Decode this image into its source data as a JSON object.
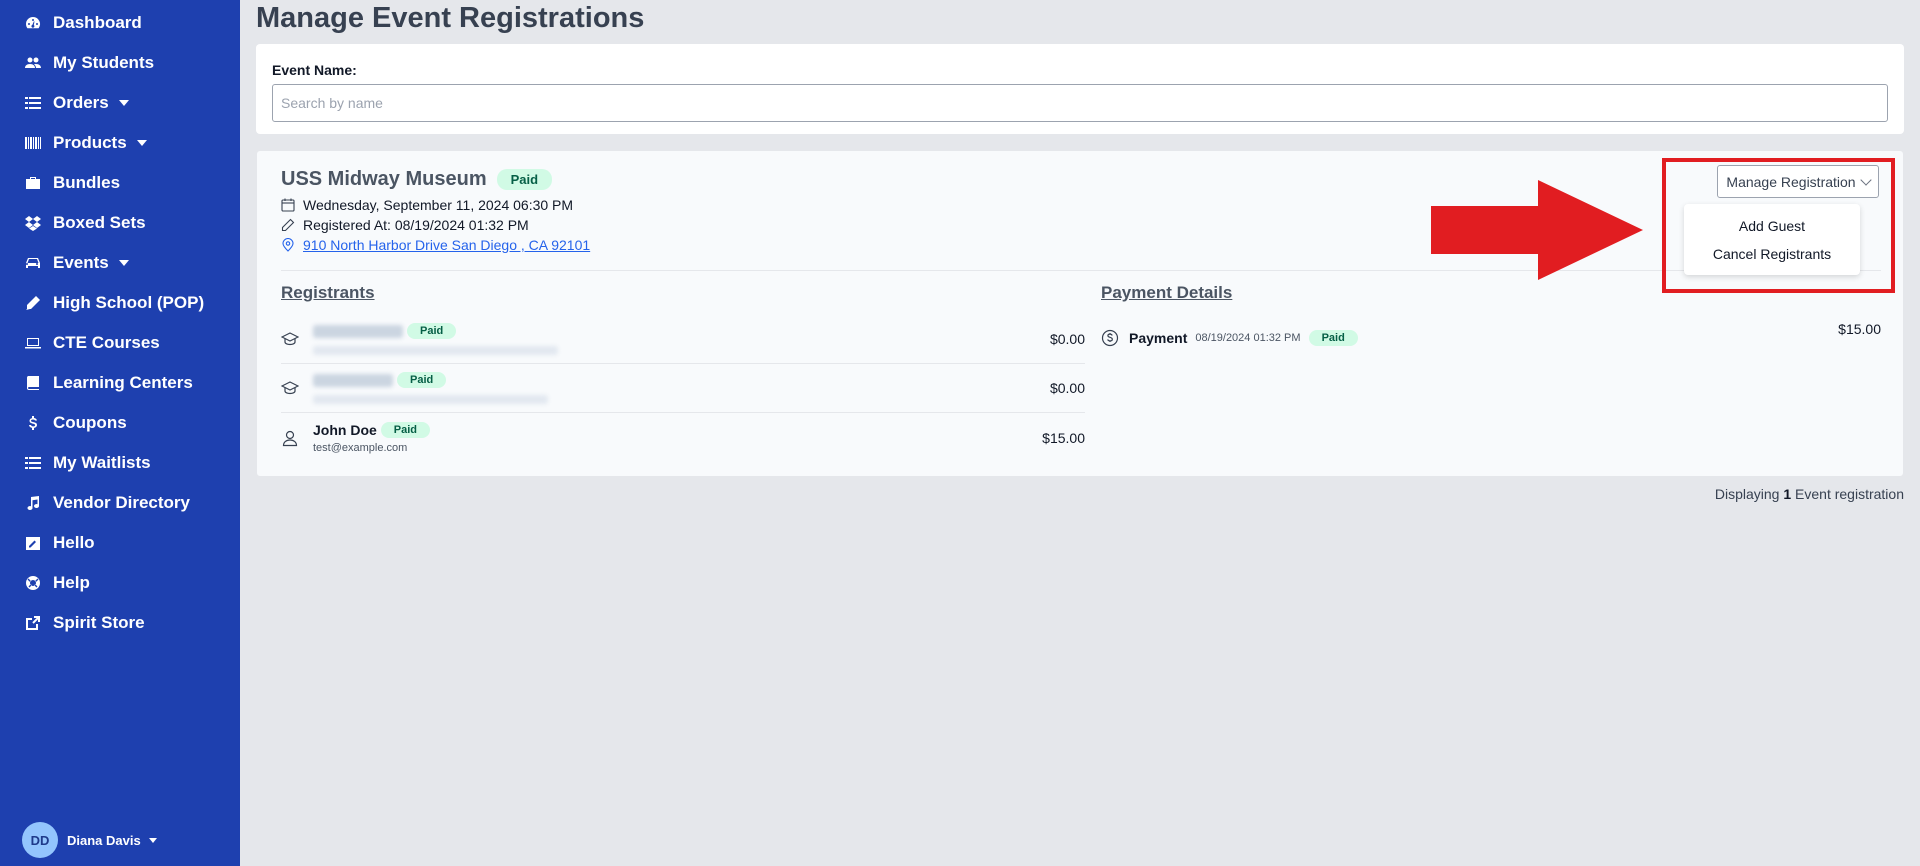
{
  "sidebar": {
    "items": [
      {
        "label": "Dashboard",
        "icon": "dashboard-icon"
      },
      {
        "label": "My Students",
        "icon": "users-icon"
      },
      {
        "label": "Orders",
        "icon": "list-icon",
        "has_caret": true
      },
      {
        "label": "Products",
        "icon": "barcode-icon",
        "has_caret": true
      },
      {
        "label": "Bundles",
        "icon": "briefcase-icon"
      },
      {
        "label": "Boxed Sets",
        "icon": "dropbox-icon"
      },
      {
        "label": "Events",
        "icon": "car-icon",
        "has_caret": true
      },
      {
        "label": "High School (POP)",
        "icon": "pencil-icon"
      },
      {
        "label": "CTE Courses",
        "icon": "laptop-icon"
      },
      {
        "label": "Learning Centers",
        "icon": "book-icon"
      },
      {
        "label": "Coupons",
        "icon": "dollar-icon"
      },
      {
        "label": "My Waitlists",
        "icon": "list-icon"
      },
      {
        "label": "Vendor Directory",
        "icon": "music-icon"
      },
      {
        "label": "Hello",
        "icon": "edit-square-icon"
      },
      {
        "label": "Help",
        "icon": "lifebuoy-icon"
      },
      {
        "label": "Spirit Store",
        "icon": "external-link-icon"
      }
    ],
    "user": {
      "initials": "DD",
      "name": "Diana Davis"
    }
  },
  "page": {
    "title": "Manage Event Registrations"
  },
  "filter": {
    "label": "Event Name:",
    "placeholder": "Search by name",
    "value": ""
  },
  "event": {
    "title": "USS Midway Museum",
    "status": "Paid",
    "datetime": "Wednesday, September 11, 2024 06:30 PM",
    "registered_at": "Registered At: 08/19/2024 01:32 PM",
    "address": "910 North Harbor Drive San Diego , CA 92101",
    "manage_label": "Manage Registration",
    "menu": [
      "Add Guest",
      "Cancel Registrants"
    ]
  },
  "registrants": {
    "heading": "Registrants",
    "rows": [
      {
        "type": "student",
        "name": "",
        "email": "",
        "status": "Paid",
        "amount": "$0.00"
      },
      {
        "type": "student",
        "name": "",
        "email": "",
        "status": "Paid",
        "amount": "$0.00"
      },
      {
        "type": "guest",
        "name": "John Doe",
        "email": "test@example.com",
        "status": "Paid",
        "amount": "$15.00"
      }
    ]
  },
  "payment": {
    "heading": "Payment Details",
    "label": "Payment",
    "date": "08/19/2024 01:32 PM",
    "status": "Paid",
    "amount": "$15.00"
  },
  "footer": {
    "prefix": "Displaying ",
    "count": "1",
    "suffix": " Event registration"
  },
  "colors": {
    "sidebar": "#1e40af",
    "badge_bg": "#d1fae5",
    "badge_text": "#065f46",
    "highlight": "#e11d21",
    "link": "#2563eb"
  }
}
